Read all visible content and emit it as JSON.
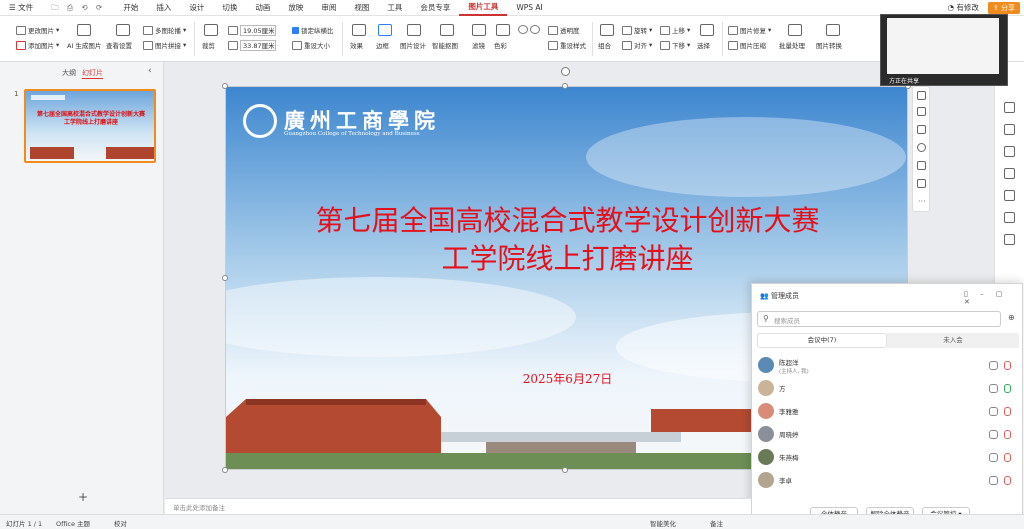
{
  "menu": {
    "file": "文件",
    "items": [
      "开始",
      "插入",
      "设计",
      "切换",
      "动画",
      "放映",
      "审阅",
      "视图",
      "工具",
      "会员专享",
      "图片工具",
      "WPS AI"
    ],
    "active_index": 10,
    "modify": "有修改",
    "share": "分享"
  },
  "ribbon": {
    "change_pic": "更改图片",
    "add_pic": "添加图片",
    "ai_pic": "AI 生成图片",
    "pic_settings": "查看设置",
    "multi_pic": "多图轮播",
    "pic_splice": "图片拼接",
    "crop": "裁剪",
    "height": "19.05厘米",
    "width": "33.87厘米",
    "lock_ratio": "锁定纵横比",
    "reset_size": "重设大小",
    "effect": "效果",
    "border": "边框",
    "pic_design": "图片设计",
    "smart_crop": "智能抠图",
    "filter": "滤镜",
    "color": "色彩",
    "transparent": "透明度",
    "reset_style": "重设样式",
    "combine": "组合",
    "rotate": "旋转",
    "align": "对齐",
    "up_layer": "上移",
    "down_layer": "下移",
    "select": "选择",
    "pic_repair": "图片修复",
    "pic_compress": "图片压缩",
    "batch": "批量处理",
    "pic_convert": "图片转换"
  },
  "left": {
    "tab_outline": "大纲",
    "tab_slides": "幻灯片",
    "slide_num": "1",
    "thumb_title": "第七届全国高校混合式教学设计创新大赛",
    "thumb_sub": "工学院线上打磨讲座"
  },
  "slide": {
    "logo_cn": "廣州工商學院",
    "logo_en": "Guangzhou College of Technology and Business",
    "title1": "第七届全国高校混合式教学设计创新大赛",
    "title2": "工学院线上打磨讲座",
    "date": "2025年6月27日"
  },
  "notes_placeholder": "单击此处添加备注",
  "status": {
    "slide_count": "幻灯片 1 / 1",
    "theme": "Office 主题",
    "proof": "校对",
    "beautify": "智能美化",
    "notes": "备注"
  },
  "video": {
    "label": "方正在共享"
  },
  "meeting": {
    "title": "管理成员",
    "search_placeholder": "搜索成员",
    "tab_in": "会议中(7)",
    "tab_out": "未入会",
    "members": [
      {
        "name": "陈超洋",
        "sub": "(主持人, 我)",
        "color": "#5b8ab5"
      },
      {
        "name": "方",
        "sub": "",
        "color": "#c9b49a"
      },
      {
        "name": "李雅雅",
        "sub": "",
        "color": "#d88c7a"
      },
      {
        "name": "周晓婷",
        "sub": "",
        "color": "#8a8f99"
      },
      {
        "name": "朱燕梅",
        "sub": "",
        "color": "#6b7a56"
      },
      {
        "name": "李卓",
        "sub": "",
        "color": "#b3a48f"
      }
    ],
    "mute_all": "全体静音",
    "unmute_all": "解除全体静音",
    "control": "会议管控"
  }
}
